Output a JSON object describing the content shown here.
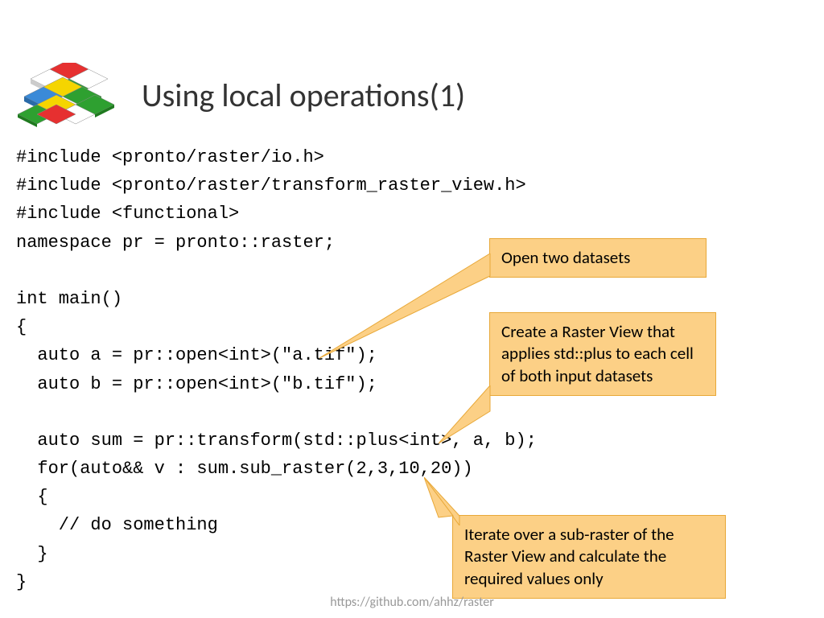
{
  "title": "Using local operations(1)",
  "code": "#include <pronto/raster/io.h>\n#include <pronto/raster/transform_raster_view.h>\n#include <functional>\nnamespace pr = pronto::raster;\n\nint main()\n{\n  auto a = pr::open<int>(\"a.tif\");\n  auto b = pr::open<int>(\"b.tif\");\n\n  auto sum = pr::transform(std::plus<int>, a, b);\n  for(auto&& v : sum.sub_raster(2,3,10,20))\n  {\n    // do something\n  }\n}",
  "callouts": {
    "c1": "Open two datasets",
    "c2": "Create a Raster View that applies std::plus to each cell of both input datasets",
    "c3": "Iterate over a sub-raster of the Raster View  and calculate the required values only"
  },
  "footer": "https://github.com/ahhz/raster"
}
